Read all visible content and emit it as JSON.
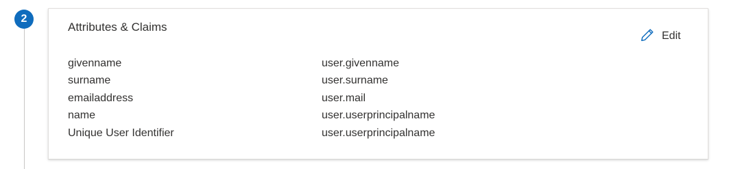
{
  "step": {
    "number": "2"
  },
  "section": {
    "title": "Attributes & Claims",
    "edit_label": "Edit"
  },
  "claims": [
    {
      "name": "givenname",
      "value": "user.givenname"
    },
    {
      "name": "surname",
      "value": "user.surname"
    },
    {
      "name": "emailaddress",
      "value": "user.mail"
    },
    {
      "name": "name",
      "value": "user.userprincipalname"
    },
    {
      "name": "Unique User Identifier",
      "value": "user.userprincipalname"
    }
  ],
  "colors": {
    "accent": "#0f6cbd",
    "text": "#323130",
    "border": "#e1dfdd"
  },
  "icons": {
    "edit": "pencil-icon"
  }
}
